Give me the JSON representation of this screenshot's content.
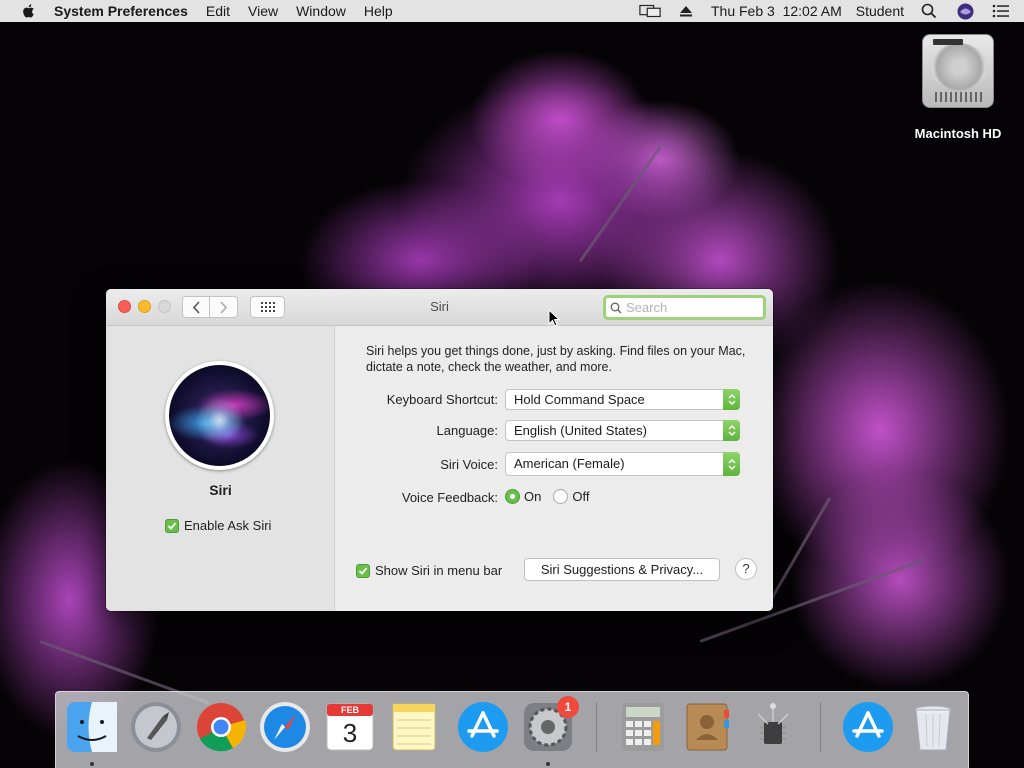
{
  "menubar": {
    "app_name": "System Preferences",
    "menus": [
      "Edit",
      "View",
      "Window",
      "Help"
    ],
    "datetime": "Thu Feb 3  12:02 AM",
    "user": "Student"
  },
  "desktop": {
    "hd_label": "Macintosh HD"
  },
  "window": {
    "title": "Siri",
    "search_placeholder": "Search",
    "siri_label": "Siri",
    "enable_label": "Enable Ask Siri",
    "enable_checked": true,
    "description": "Siri helps you get things done, just by asking. Find files on your Mac, dictate a note, check the weather, and more.",
    "keyboard_shortcut_label": "Keyboard Shortcut:",
    "keyboard_shortcut_value": "Hold Command Space",
    "language_label": "Language:",
    "language_value": "English (United States)",
    "voice_label": "Siri Voice:",
    "voice_value": "American (Female)",
    "feedback_label": "Voice Feedback:",
    "feedback_on": "On",
    "feedback_off": "Off",
    "feedback_selected": "On",
    "show_menubar_label": "Show Siri in menu bar",
    "show_menubar_checked": true,
    "suggestions_button": "Siri Suggestions & Privacy...",
    "help_button": "?"
  },
  "dock": {
    "calendar_month": "FEB",
    "calendar_day": "3",
    "sysprefs_badge": "1",
    "items": [
      "finder-icon",
      "launchpad-icon",
      "chrome-icon",
      "safari-icon",
      "calendar-icon",
      "notes-icon",
      "app-store-icon",
      "system-preferences-icon",
      "calculator-icon",
      "contacts-icon",
      "system-information-icon",
      "app-store-downloads-icon",
      "trash-icon"
    ]
  },
  "colors": {
    "accent_green": "#6abf4b",
    "close_red": "#fc5f57",
    "minimize_yellow": "#fdbc2e"
  }
}
